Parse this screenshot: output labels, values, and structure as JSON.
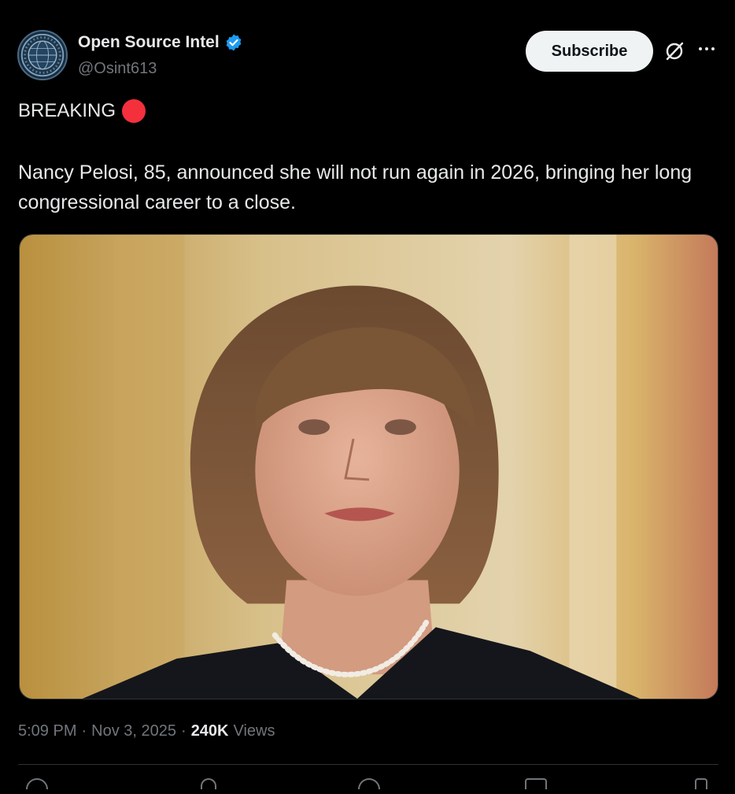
{
  "account": {
    "name": "Open Source Intel",
    "handle": "@Osint613",
    "verified_icon": "verified-badge-icon",
    "avatar_icon": "globe-seal-avatar"
  },
  "header": {
    "subscribe_label": "Subscribe",
    "grok_icon": "grok-icon",
    "more_icon": "more-options-icon"
  },
  "post": {
    "tag": "BREAKING",
    "tag_icon": "red-circle-emoji",
    "text": "Nancy Pelosi, 85, announced she will not run again in 2026, bringing her long congressional career to a close.",
    "media_alt": "photo"
  },
  "meta": {
    "time": "5:09 PM",
    "sep1": "·",
    "date": "Nov 3, 2025",
    "sep2": "·",
    "views_count": "240K",
    "views_label": "Views"
  },
  "colors": {
    "background": "#000000",
    "text": "#e7e9ea",
    "muted": "#71767b",
    "verified": "#1d9bf0",
    "red_dot": "#f4303c"
  }
}
